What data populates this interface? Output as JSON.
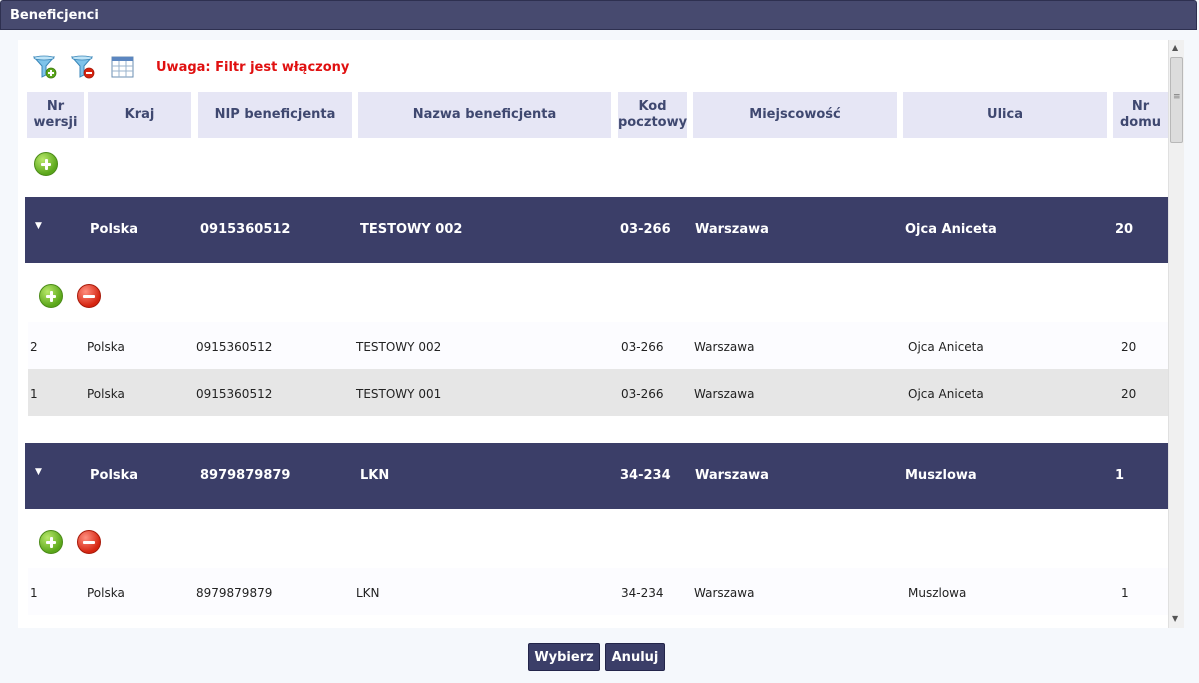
{
  "window": {
    "title": "Beneficjenci"
  },
  "toolbar": {
    "add_filter_icon": "filter-add-icon",
    "remove_filter_icon": "filter-remove-icon",
    "columns_icon": "table-columns-icon",
    "filter_warning": "Uwaga: Filtr jest włączony"
  },
  "columns": {
    "version_line1": "Nr",
    "version_line2": "wersji",
    "country": "Kraj",
    "nip": "NIP beneficjenta",
    "name": "Nazwa beneficjenta",
    "postal_line1": "Kod",
    "postal_line2": "pocztowy",
    "city": "Miejscowość",
    "street": "Ulica",
    "house_line1": "Nr",
    "house_line2": "domu"
  },
  "groups": [
    {
      "header": {
        "country": "Polska",
        "nip": "0915360512",
        "name": "TESTOWY 002",
        "postal": "03-266",
        "city": "Warszawa",
        "street": "Ojca Aniceta",
        "house": "20"
      },
      "rows": [
        {
          "version": "2",
          "country": "Polska",
          "nip": "0915360512",
          "name": "TESTOWY 002",
          "postal": "03-266",
          "city": "Warszawa",
          "street": "Ojca Aniceta",
          "house": "20"
        },
        {
          "version": "1",
          "country": "Polska",
          "nip": "0915360512",
          "name": "TESTOWY 001",
          "postal": "03-266",
          "city": "Warszawa",
          "street": "Ojca Aniceta",
          "house": "20"
        }
      ]
    },
    {
      "header": {
        "country": "Polska",
        "nip": "8979879879",
        "name": "LKN",
        "postal": "34-234",
        "city": "Warszawa",
        "street": "Muszlowa",
        "house": "1"
      },
      "rows": [
        {
          "version": "1",
          "country": "Polska",
          "nip": "8979879879",
          "name": "LKN",
          "postal": "34-234",
          "city": "Warszawa",
          "street": "Muszlowa",
          "house": "1"
        }
      ]
    }
  ],
  "footer": {
    "select_label": "Wybierz",
    "cancel_label": "Anuluj"
  },
  "colors": {
    "header_bar": "#474a6f",
    "group_header": "#3b3e68",
    "column_header": "#e6e6f5",
    "warning": "#e01010"
  }
}
